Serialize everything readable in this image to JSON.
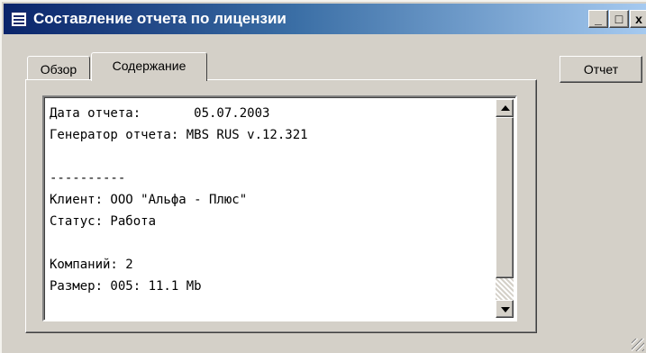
{
  "window": {
    "title": "Составление отчета по лицензии",
    "controls": {
      "minimize": "_",
      "maximize": "□",
      "close": "x"
    }
  },
  "tabs": [
    {
      "label": "Обзор",
      "active": false
    },
    {
      "label": "Содержание",
      "active": true
    }
  ],
  "report_button": "Отчет",
  "report_lines": [
    "Дата отчета:       05.07.2003",
    "Генератор отчета: MBS RUS v.12.321",
    "",
    "----------",
    "Клиент: ООО \"Альфа - Плюс\"",
    "Статус: Работа",
    "",
    "Компаний: 2",
    "Размер: 005: 11.1 Mb"
  ],
  "icons": {
    "app": "report-window-icon",
    "scroll_up": "scroll-up-arrow-icon",
    "scroll_down": "scroll-down-arrow-icon"
  },
  "scroll_position": 0.88
}
